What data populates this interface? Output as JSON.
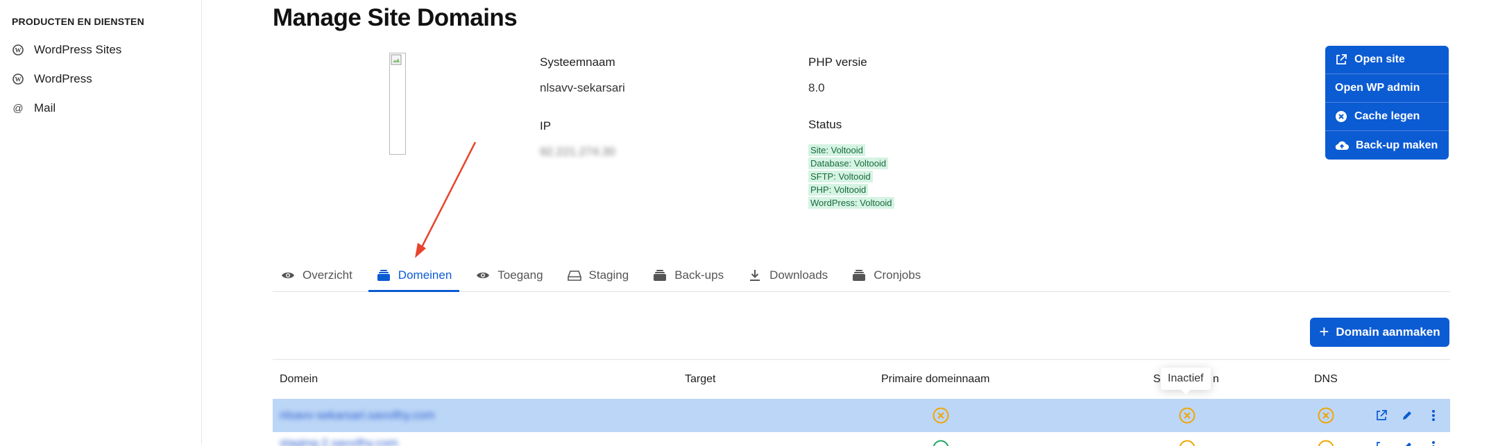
{
  "sidebar": {
    "heading": "PRODUCTEN EN DIENSTEN",
    "items": [
      {
        "label": "WordPress Sites",
        "icon": "wordpress-icon"
      },
      {
        "label": "WordPress",
        "icon": "wordpress-icon"
      },
      {
        "label": "Mail",
        "icon": "at-icon"
      }
    ]
  },
  "page": {
    "title": "Manage Site Domains"
  },
  "info": {
    "system_name_label": "Systeemnaam",
    "system_name_value": "nlsavv-sekarsari",
    "php_label": "PHP versie",
    "php_value": "8.0",
    "ip_label": "IP",
    "ip_value": "92.221.274.30",
    "status_label": "Status",
    "statuses": [
      "Site: Voltooid",
      "Database: Voltooid",
      "SFTP: Voltooid",
      "PHP: Voltooid",
      "WordPress: Voltooid"
    ]
  },
  "actions": {
    "open_site": "Open site",
    "open_wp_admin": "Open WP admin",
    "clear_cache": "Cache legen",
    "backup": "Back-up maken"
  },
  "tabs": [
    {
      "label": "Overzicht",
      "icon": "eye-icon",
      "active": false
    },
    {
      "label": "Domeinen",
      "icon": "layers-icon",
      "active": true
    },
    {
      "label": "Toegang",
      "icon": "eye-icon",
      "active": false
    },
    {
      "label": "Staging",
      "icon": "drive-icon",
      "active": false
    },
    {
      "label": "Back-ups",
      "icon": "layers-icon",
      "active": false
    },
    {
      "label": "Downloads",
      "icon": "download-icon",
      "active": false
    },
    {
      "label": "Cronjobs",
      "icon": "layers-icon",
      "active": false
    }
  ],
  "create_domain_label": "Domain aanmaken",
  "table": {
    "headers": {
      "domain": "Domein",
      "target": "Target",
      "primary": "Primaire domeinnaam",
      "ssl_left": "S",
      "ssl_right": "n",
      "dns": "DNS"
    },
    "tooltip": "Inactief",
    "rows": [
      {
        "domain": "nlsavv-sekarsari.savvilhy.com",
        "selected": true
      },
      {
        "domain": "staging-2.savvilhy.com",
        "selected": false
      }
    ]
  },
  "colors": {
    "primary": "#0b5bd3",
    "selected_row": "#bcd6f7",
    "status_inactive": "#f0a500",
    "status_ok": "#1fa463",
    "annotation_arrow": "#e8432c"
  }
}
